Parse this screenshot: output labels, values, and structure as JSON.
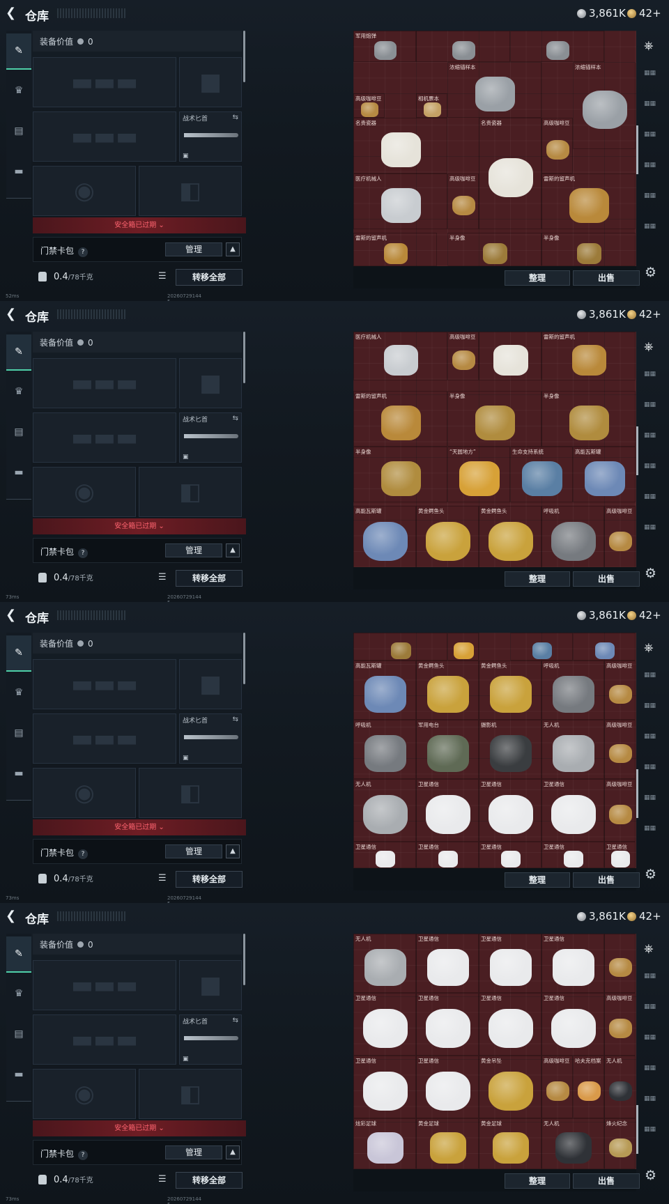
{
  "header": {
    "title": "仓库",
    "currency1": "3,861K",
    "currency2": "42+"
  },
  "equip": {
    "value_label": "装备价值",
    "value": "0",
    "knife_label": "战术匕首"
  },
  "safe_box": {
    "warning": "安全箱已过期"
  },
  "card_bag": {
    "label": "门禁卡包",
    "manage": "管理"
  },
  "capacity": {
    "value": "0.4",
    "max": "/78千克",
    "transfer_all": "转移全部"
  },
  "status": {
    "ping_values": [
      "52ms",
      "73ms",
      "73ms",
      "73ms"
    ],
    "version": "20260729144 5"
  },
  "actions": {
    "sort": "整理",
    "sell": "出售"
  },
  "colors": {
    "grid_bg": "#4a1e22",
    "accent": "#4fd0a9",
    "warning": "#ff6470"
  },
  "icons": [
    "back-icon",
    "silver-coin-icon",
    "gold-coin-icon",
    "gun-icon",
    "helmet-icon",
    "backpack-icon",
    "briefcase-icon",
    "lock-icon",
    "swap-icon",
    "list-icon",
    "home-icon",
    "gear-icon"
  ],
  "panels": [
    {
      "items": [
        {
          "name": "军用炮弹",
          "color": "#8a8f94"
        },
        {
          "name": "",
          "color": "#8a8f94"
        },
        {
          "name": "",
          "color": "#8a8f94"
        },
        {
          "name": "浓缩锚样本",
          "color": "#9aa0a6"
        },
        {
          "name": "浓缩锚样本",
          "color": "#9aa0a6"
        },
        {
          "name": "高级咖啡豆",
          "color": "#b68a43"
        },
        {
          "name": "相机票本",
          "color": "#c4a165"
        },
        {
          "name": "名贵瓷器",
          "color": "#e6e3da"
        },
        {
          "name": "名贵瓷器",
          "color": "#e6e3da"
        },
        {
          "name": "高级咖啡豆",
          "color": "#b68a43"
        },
        {
          "name": "医疗机械人",
          "color": "#c8ccd0"
        },
        {
          "name": "高级咖啡豆",
          "color": "#b68a43"
        },
        {
          "name": "雷斯的留声机",
          "color": "#b9893a"
        },
        {
          "name": "雷斯的留声机",
          "color": "#b9893a"
        },
        {
          "name": "半身像",
          "color": "#9c7b3a"
        },
        {
          "name": "半身像",
          "color": "#9c7b3a"
        }
      ]
    },
    {
      "items": [
        {
          "name": "医疗机械人",
          "color": "#c8ccd0"
        },
        {
          "name": "高级咖啡豆",
          "color": "#b68a43"
        },
        {
          "name": "",
          "color": "#e6e3da"
        },
        {
          "name": "雷斯的留声机",
          "color": "#b9893a"
        },
        {
          "name": "雷斯的留声机",
          "color": "#b9893a"
        },
        {
          "name": "半身像",
          "color": "#b08c3e"
        },
        {
          "name": "半身像",
          "color": "#b08c3e"
        },
        {
          "name": "半身像",
          "color": "#b08c3e"
        },
        {
          "name": "“天圆地方”",
          "color": "#d7a137"
        },
        {
          "name": "生命支持系统",
          "color": "#5a7fa4"
        },
        {
          "name": "高能瓦斯罐",
          "color": "#6d89b6"
        },
        {
          "name": "高能瓦斯罐",
          "color": "#6d89b6"
        },
        {
          "name": "黄金鳄鱼头",
          "color": "#c9a23c"
        },
        {
          "name": "黄金鳄鱼头",
          "color": "#c9a23c"
        },
        {
          "name": "呼吸机",
          "color": "#767a7f"
        },
        {
          "name": "高级咖啡豆",
          "color": "#b68a43"
        }
      ]
    },
    {
      "items": [
        {
          "name": "",
          "color": "#9c7b3a"
        },
        {
          "name": "",
          "color": "#d7a137"
        },
        {
          "name": "",
          "color": "#5a7fa4"
        },
        {
          "name": "",
          "color": "#6d89b6"
        },
        {
          "name": "高能瓦斯罐",
          "color": "#6d89b6"
        },
        {
          "name": "黄金鳄鱼头",
          "color": "#c9a23c"
        },
        {
          "name": "黄金鳄鱼头",
          "color": "#c9a23c"
        },
        {
          "name": "呼吸机",
          "color": "#767a7f"
        },
        {
          "name": "高级咖啡豆",
          "color": "#b68a43"
        },
        {
          "name": "呼吸机",
          "color": "#767a7f"
        },
        {
          "name": "军用电台",
          "color": "#5f6a55"
        },
        {
          "name": "摄影机",
          "color": "#3a3d40"
        },
        {
          "name": "无人机",
          "color": "#a9adb1"
        },
        {
          "name": "高级咖啡豆",
          "color": "#b68a43"
        },
        {
          "name": "无人机",
          "color": "#a9adb1"
        },
        {
          "name": "卫星通信",
          "color": "#e9eaec"
        },
        {
          "name": "卫星通信",
          "color": "#e9eaec"
        },
        {
          "name": "卫星通信",
          "color": "#e9eaec"
        },
        {
          "name": "高级咖啡豆",
          "color": "#b68a43"
        },
        {
          "name": "卫星通信",
          "color": "#e9eaec"
        },
        {
          "name": "卫星通信",
          "color": "#e9eaec"
        },
        {
          "name": "卫星通信",
          "color": "#e9eaec"
        },
        {
          "name": "卫星通信",
          "color": "#e9eaec"
        },
        {
          "name": "卫星通信",
          "color": "#e9eaec"
        }
      ]
    },
    {
      "items": [
        {
          "name": "无人机",
          "color": "#a9adb1"
        },
        {
          "name": "卫星通信",
          "color": "#e9eaec"
        },
        {
          "name": "卫星通信",
          "color": "#e9eaec"
        },
        {
          "name": "卫星通信",
          "color": "#e9eaec"
        },
        {
          "name": "",
          "color": "#b68a43"
        },
        {
          "name": "卫星通信",
          "color": "#e9eaec"
        },
        {
          "name": "卫星通信",
          "color": "#e9eaec"
        },
        {
          "name": "卫星通信",
          "color": "#e9eaec"
        },
        {
          "name": "卫星通信",
          "color": "#e9eaec"
        },
        {
          "name": "高级咖啡豆",
          "color": "#b68a43"
        },
        {
          "name": "卫星通信",
          "color": "#e9eaec"
        },
        {
          "name": "卫星通信",
          "color": "#e9eaec"
        },
        {
          "name": "黄金吊坠",
          "color": "#c9a23c"
        },
        {
          "name": "高级咖啡豆",
          "color": "#b68a43"
        },
        {
          "name": "哈夫克档案",
          "color": "#d99a4a"
        },
        {
          "name": "无人机",
          "color": "#2f3237"
        },
        {
          "name": "炫彩足球",
          "color": "#c9c6d8"
        },
        {
          "name": "黄金足球",
          "color": "#c9a23c"
        },
        {
          "name": "黄金足球",
          "color": "#c9a23c"
        },
        {
          "name": "无人机",
          "color": "#2f3237"
        },
        {
          "name": "烽火纪念",
          "color": "#b79a55"
        }
      ]
    }
  ]
}
